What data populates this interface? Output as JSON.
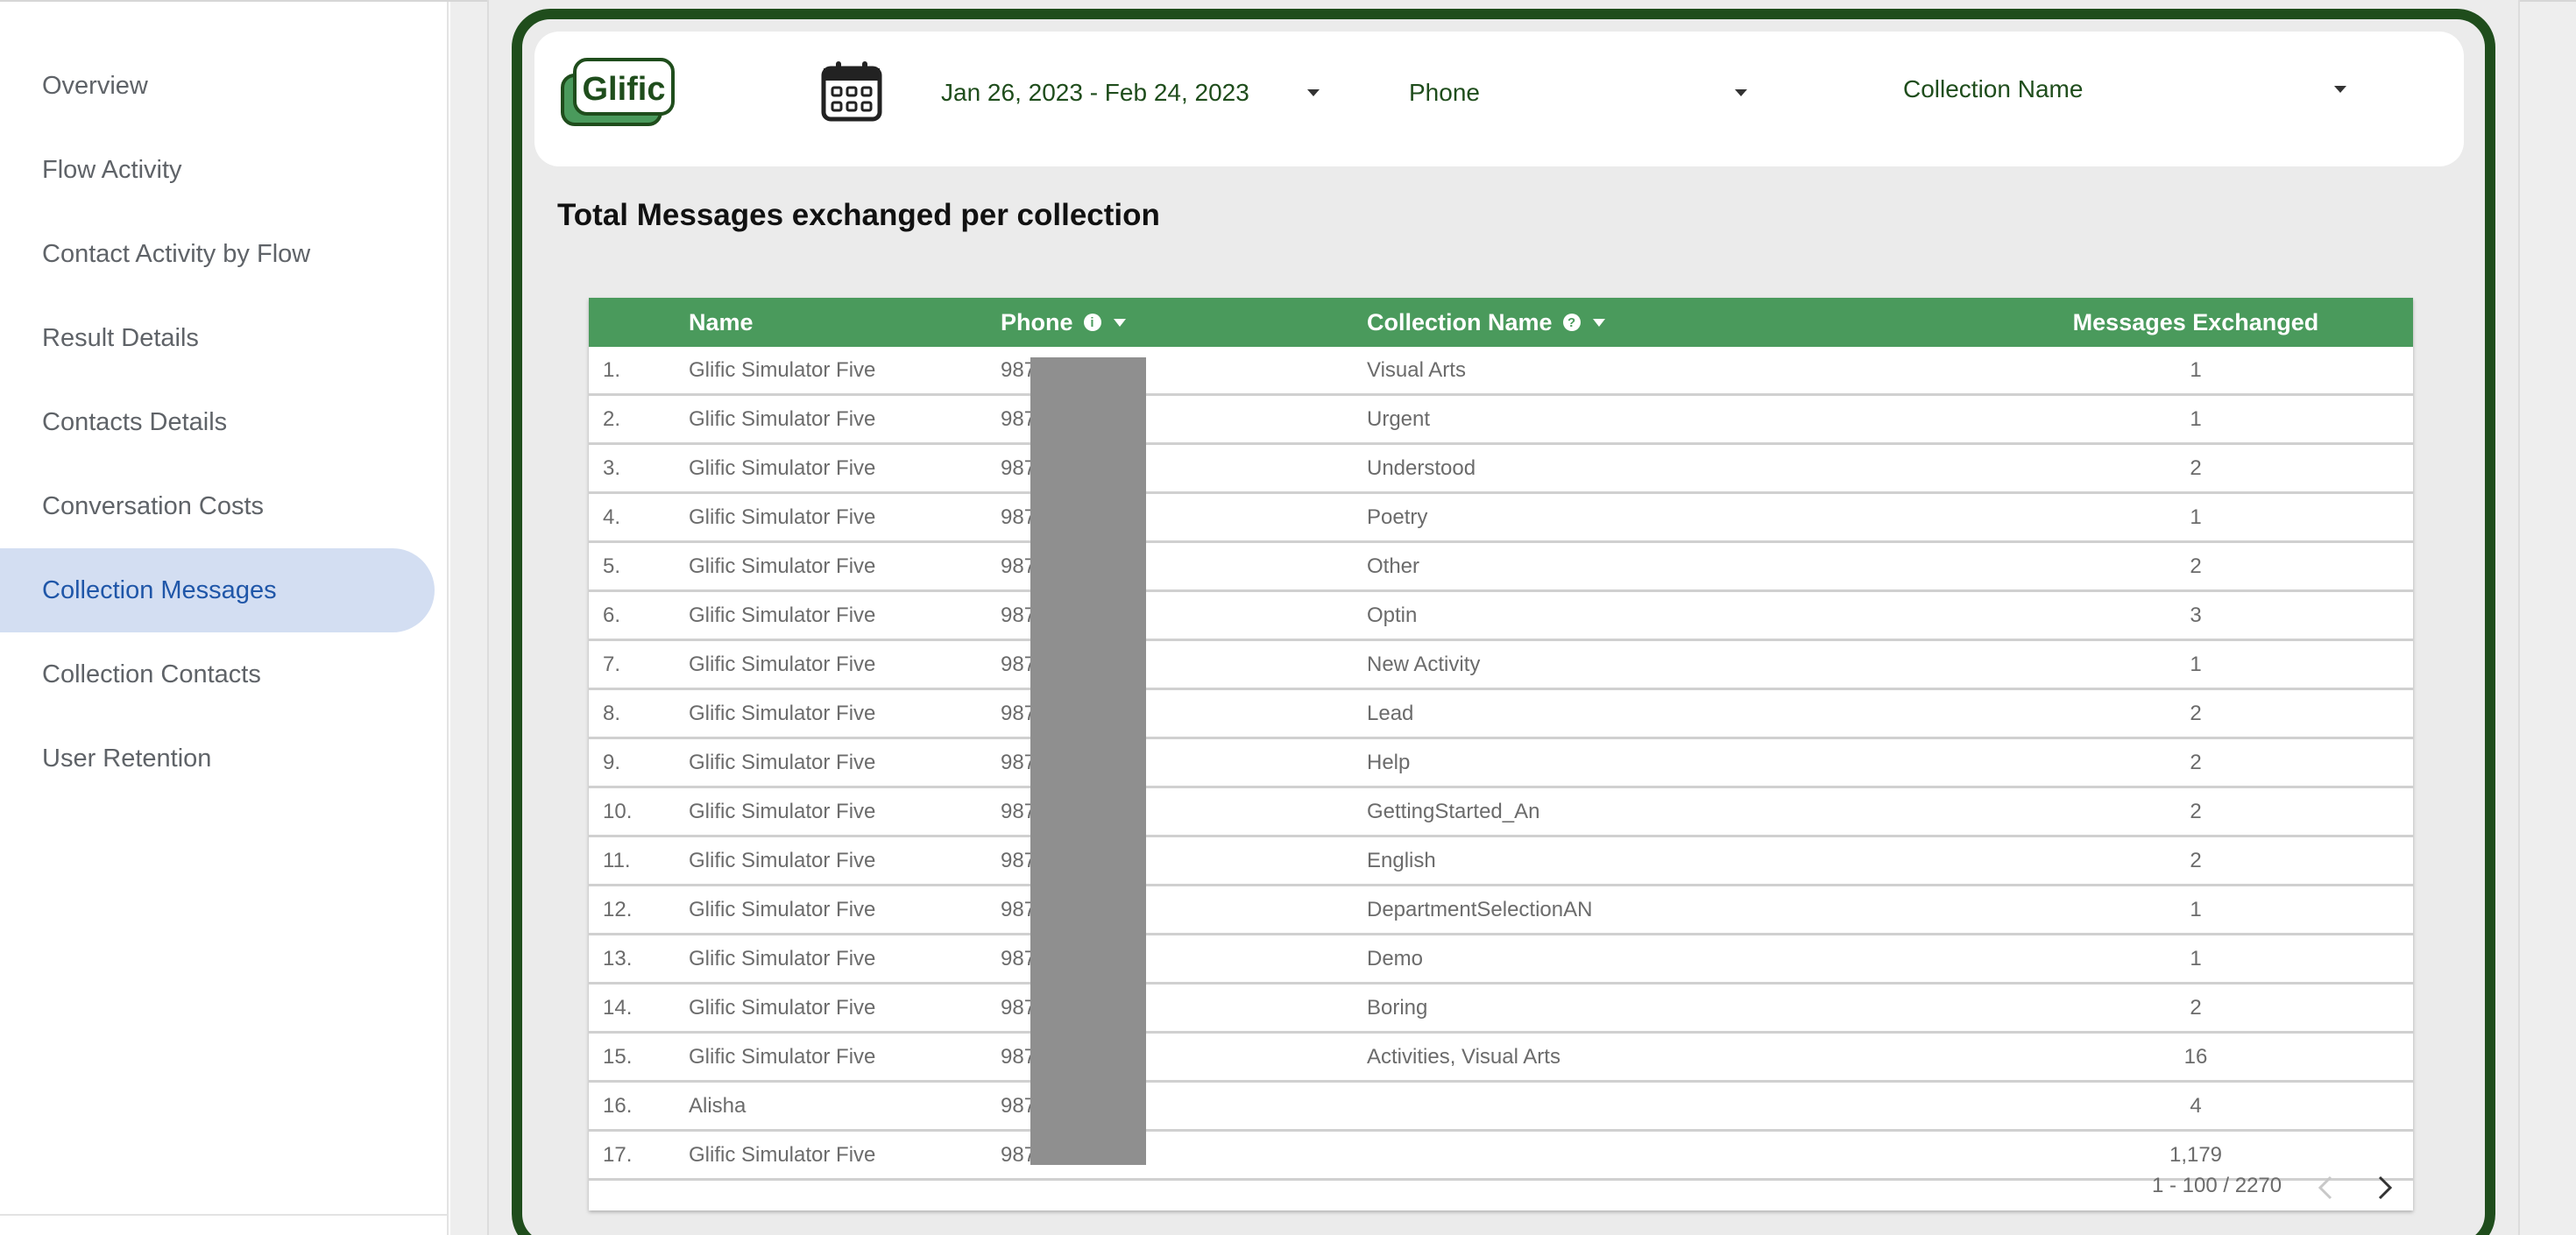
{
  "sidebar": {
    "items": [
      {
        "label": "Overview",
        "active": false
      },
      {
        "label": "Flow Activity",
        "active": false
      },
      {
        "label": "Contact Activity by Flow",
        "active": false
      },
      {
        "label": "Result Details",
        "active": false
      },
      {
        "label": "Contacts Details",
        "active": false
      },
      {
        "label": "Conversation Costs",
        "active": false
      },
      {
        "label": "Collection Messages",
        "active": true
      },
      {
        "label": "Collection Contacts",
        "active": false
      },
      {
        "label": "User Retention",
        "active": false
      }
    ]
  },
  "header": {
    "logo_text": "Glific",
    "calendar_icon": "calendar-icon",
    "date_range": "Jan 26, 2023 - Feb 24, 2023",
    "phone_filter": "Phone",
    "collection_filter": "Collection Name"
  },
  "section_title": "Total Messages exchanged per collection",
  "table": {
    "columns": [
      "Name",
      "Phone",
      "Collection Name",
      "Messages Exchanged"
    ],
    "rows": [
      {
        "idx": "1.",
        "name": "Glific Simulator Five",
        "phone": "987",
        "collection": "Visual Arts",
        "messages": "1"
      },
      {
        "idx": "2.",
        "name": "Glific Simulator Five",
        "phone": "987",
        "collection": "Urgent",
        "messages": "1"
      },
      {
        "idx": "3.",
        "name": "Glific Simulator Five",
        "phone": "987",
        "collection": "Understood",
        "messages": "2"
      },
      {
        "idx": "4.",
        "name": "Glific Simulator Five",
        "phone": "987",
        "collection": "Poetry",
        "messages": "1"
      },
      {
        "idx": "5.",
        "name": "Glific Simulator Five",
        "phone": "987",
        "collection": "Other",
        "messages": "2"
      },
      {
        "idx": "6.",
        "name": "Glific Simulator Five",
        "phone": "987",
        "collection": "Optin",
        "messages": "3"
      },
      {
        "idx": "7.",
        "name": "Glific Simulator Five",
        "phone": "987",
        "collection": "New Activity",
        "messages": "1"
      },
      {
        "idx": "8.",
        "name": "Glific Simulator Five",
        "phone": "987",
        "collection": "Lead",
        "messages": "2"
      },
      {
        "idx": "9.",
        "name": "Glific Simulator Five",
        "phone": "987",
        "collection": "Help",
        "messages": "2"
      },
      {
        "idx": "10.",
        "name": "Glific Simulator Five",
        "phone": "987",
        "collection": "GettingStarted_An",
        "messages": "2"
      },
      {
        "idx": "11.",
        "name": "Glific Simulator Five",
        "phone": "987",
        "collection": "English",
        "messages": "2"
      },
      {
        "idx": "12.",
        "name": "Glific Simulator Five",
        "phone": "987",
        "collection": "DepartmentSelectionAN",
        "messages": "1"
      },
      {
        "idx": "13.",
        "name": "Glific Simulator Five",
        "phone": "987",
        "collection": "Demo",
        "messages": "1"
      },
      {
        "idx": "14.",
        "name": "Glific Simulator Five",
        "phone": "987",
        "collection": "Boring",
        "messages": "2"
      },
      {
        "idx": "15.",
        "name": "Glific Simulator Five",
        "phone": "987",
        "collection": "Activities, Visual Arts",
        "messages": "16"
      },
      {
        "idx": "16.",
        "name": "Alisha",
        "phone": "987",
        "collection": "",
        "messages": "4"
      },
      {
        "idx": "17.",
        "name": "Glific Simulator Five",
        "phone": "987",
        "collection": "",
        "messages": "1,179"
      }
    ],
    "pagination": "1 - 100 / 2270"
  },
  "colors": {
    "frame_green": "#1f4d1c",
    "header_green": "#4a9a5c",
    "active_bg": "#d3def2",
    "active_text": "#1f56a8"
  }
}
